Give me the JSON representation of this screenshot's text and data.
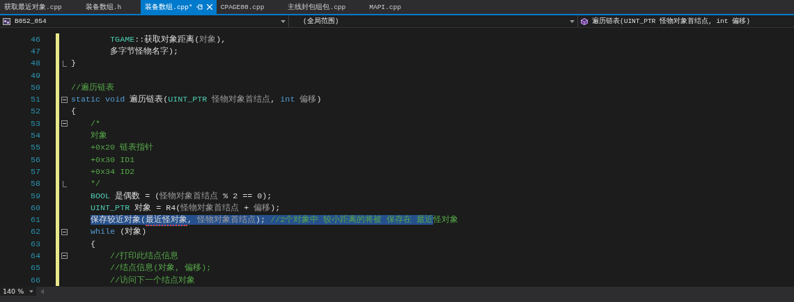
{
  "tabs": [
    {
      "label": "获取最近对象.cpp",
      "selected": false,
      "pinned": false
    },
    {
      "label": "装备数组.h",
      "selected": false,
      "pinned": false
    },
    {
      "label": "装备数组.cpp*",
      "selected": true,
      "pinned": true
    },
    {
      "label": "CPAGE00.cpp",
      "selected": false,
      "pinned": false
    },
    {
      "label": "主线封包组包.cpp",
      "selected": false,
      "pinned": false
    },
    {
      "label": "MAPI.cpp",
      "selected": false,
      "pinned": false
    }
  ],
  "navigation_bar": {
    "project": "B052_054",
    "scope": "(全局范围)",
    "member": "遍历链表(UINT_PTR 怪物对象首结点, int 偏移)"
  },
  "code_lines": [
    {
      "number": "46",
      "changed": true,
      "foldable": false,
      "block_end": false,
      "tokens": [
        {
          "kind": "type",
          "text": "        TGAME",
          "selected": false,
          "squiggle": false
        },
        {
          "kind": "plain",
          "text": "::获取对象距离(",
          "selected": false,
          "squiggle": false
        },
        {
          "kind": "param",
          "text": "对象",
          "selected": false,
          "squiggle": false
        },
        {
          "kind": "plain",
          "text": "),",
          "selected": false,
          "squiggle": false
        }
      ]
    },
    {
      "number": "47",
      "changed": true,
      "foldable": false,
      "block_end": false,
      "tokens": [
        {
          "kind": "plain",
          "text": "        多字节怪物名字);",
          "selected": false,
          "squiggle": false
        }
      ]
    },
    {
      "number": "48",
      "changed": true,
      "foldable": false,
      "block_end": true,
      "tokens": [
        {
          "kind": "plain",
          "text": "}",
          "selected": false,
          "squiggle": false
        }
      ]
    },
    {
      "number": "49",
      "changed": true,
      "foldable": false,
      "block_end": false
    },
    {
      "number": "50",
      "changed": true,
      "foldable": false,
      "block_end": false,
      "tokens": [
        {
          "kind": "comment",
          "text": "//遍历链表",
          "selected": false,
          "squiggle": false
        }
      ]
    },
    {
      "number": "51",
      "changed": true,
      "foldable": true,
      "block_end": false,
      "tokens": [
        {
          "kind": "keyword",
          "text": "static",
          "selected": false,
          "squiggle": false
        },
        {
          "kind": "keyword",
          "text": " void",
          "selected": false,
          "squiggle": false
        },
        {
          "kind": "plain",
          "text": " 遍历链表(",
          "selected": false,
          "squiggle": false
        },
        {
          "kind": "type",
          "text": "UINT_PTR",
          "selected": false,
          "squiggle": false
        },
        {
          "kind": "param",
          "text": " 怪物对象首结点",
          "selected": false,
          "squiggle": false
        },
        {
          "kind": "plain",
          "text": ", ",
          "selected": false,
          "squiggle": false
        },
        {
          "kind": "keyword",
          "text": "int",
          "selected": false,
          "squiggle": false
        },
        {
          "kind": "param",
          "text": " 偏移",
          "selected": false,
          "squiggle": false
        },
        {
          "kind": "plain",
          "text": ")",
          "selected": false,
          "squiggle": false
        }
      ]
    },
    {
      "number": "52",
      "changed": true,
      "foldable": false,
      "block_end": false,
      "tokens": [
        {
          "kind": "plain",
          "text": "{",
          "selected": false,
          "squiggle": false
        }
      ]
    },
    {
      "number": "53",
      "changed": true,
      "foldable": true,
      "block_end": false,
      "tokens": [
        {
          "kind": "comment",
          "text": "    /*",
          "selected": false,
          "squiggle": false
        }
      ]
    },
    {
      "number": "54",
      "changed": true,
      "foldable": false,
      "block_end": false,
      "tokens": [
        {
          "kind": "comment",
          "text": "    对象",
          "selected": false,
          "squiggle": false
        }
      ]
    },
    {
      "number": "55",
      "changed": true,
      "foldable": false,
      "block_end": false,
      "tokens": [
        {
          "kind": "comment",
          "text": "    +0x20 链表指针",
          "selected": false,
          "squiggle": false
        }
      ]
    },
    {
      "number": "56",
      "changed": true,
      "foldable": false,
      "block_end": false,
      "tokens": [
        {
          "kind": "comment",
          "text": "    +0x30 ID1",
          "selected": false,
          "squiggle": false
        }
      ]
    },
    {
      "number": "57",
      "changed": true,
      "foldable": false,
      "block_end": false,
      "tokens": [
        {
          "kind": "comment",
          "text": "    +0x34 ID2",
          "selected": false,
          "squiggle": false
        }
      ]
    },
    {
      "number": "58",
      "changed": true,
      "foldable": false,
      "block_end": true,
      "tokens": [
        {
          "kind": "comment",
          "text": "    */",
          "selected": false,
          "squiggle": false
        }
      ]
    },
    {
      "number": "59",
      "changed": true,
      "foldable": false,
      "block_end": false,
      "tokens": [
        {
          "kind": "type",
          "text": "    BOOL",
          "selected": false,
          "squiggle": false
        },
        {
          "kind": "plain",
          "text": " 是偶数 = (",
          "selected": false,
          "squiggle": false
        },
        {
          "kind": "param",
          "text": "怪物对象首结点",
          "selected": false,
          "squiggle": false
        },
        {
          "kind": "plain",
          "text": " % 2 == 0);",
          "selected": false,
          "squiggle": false
        }
      ]
    },
    {
      "number": "60",
      "changed": true,
      "foldable": false,
      "block_end": false,
      "tokens": [
        {
          "kind": "type",
          "text": "    UINT_PTR",
          "selected": false,
          "squiggle": false
        },
        {
          "kind": "plain",
          "text": " 对象 = R4(",
          "selected": false,
          "squiggle": false
        },
        {
          "kind": "param",
          "text": "怪物对象首结点",
          "selected": false,
          "squiggle": false
        },
        {
          "kind": "plain",
          "text": " + ",
          "selected": false,
          "squiggle": false
        },
        {
          "kind": "param",
          "text": "偏移",
          "selected": false,
          "squiggle": false
        },
        {
          "kind": "plain",
          "text": ");",
          "selected": false,
          "squiggle": false
        }
      ]
    },
    {
      "number": "61",
      "changed": true,
      "foldable": false,
      "block_end": false,
      "tokens": [
        {
          "kind": "plain",
          "text": "    保存较近对象(",
          "selected": true,
          "squiggle": false
        },
        {
          "kind": "plain",
          "text": "最近怪对象",
          "selected": true,
          "squiggle": true
        },
        {
          "kind": "plain",
          "text": ", ",
          "selected": true,
          "squiggle": false
        },
        {
          "kind": "param",
          "text": "怪物对象首结点",
          "selected": true,
          "squiggle": false
        },
        {
          "kind": "plain",
          "text": "); ",
          "selected": true,
          "squiggle": false
        },
        {
          "kind": "comment",
          "text": "//2个对象中 较小距离的将被 保存在 最近",
          "selected": true,
          "squiggle": false
        },
        {
          "kind": "comment",
          "text": "怪对象",
          "selected": false,
          "squiggle": false
        }
      ]
    },
    {
      "number": "62",
      "changed": true,
      "foldable": true,
      "block_end": false,
      "tokens": [
        {
          "kind": "keyword",
          "text": "    while",
          "selected": false,
          "squiggle": false
        },
        {
          "kind": "plain",
          "text": " (对象)",
          "selected": false,
          "squiggle": false
        }
      ]
    },
    {
      "number": "63",
      "changed": true,
      "foldable": false,
      "block_end": false,
      "tokens": [
        {
          "kind": "plain",
          "text": "    {",
          "selected": false,
          "squiggle": false
        }
      ]
    },
    {
      "number": "64",
      "changed": true,
      "foldable": true,
      "block_end": false,
      "tokens": [
        {
          "kind": "comment",
          "text": "        //打印此结点信息",
          "selected": false,
          "squiggle": false
        }
      ]
    },
    {
      "number": "65",
      "changed": true,
      "foldable": false,
      "block_end": false,
      "tokens": [
        {
          "kind": "comment",
          "text": "        //结点信息(对象, 偏移);",
          "selected": false,
          "squiggle": false
        }
      ]
    },
    {
      "number": "66",
      "changed": true,
      "foldable": false,
      "block_end": false,
      "tokens": [
        {
          "kind": "comment",
          "text": "        //访问下一个结点对象",
          "selected": false,
          "squiggle": false
        }
      ]
    }
  ],
  "status_bar": {
    "zoom": "140 %"
  }
}
